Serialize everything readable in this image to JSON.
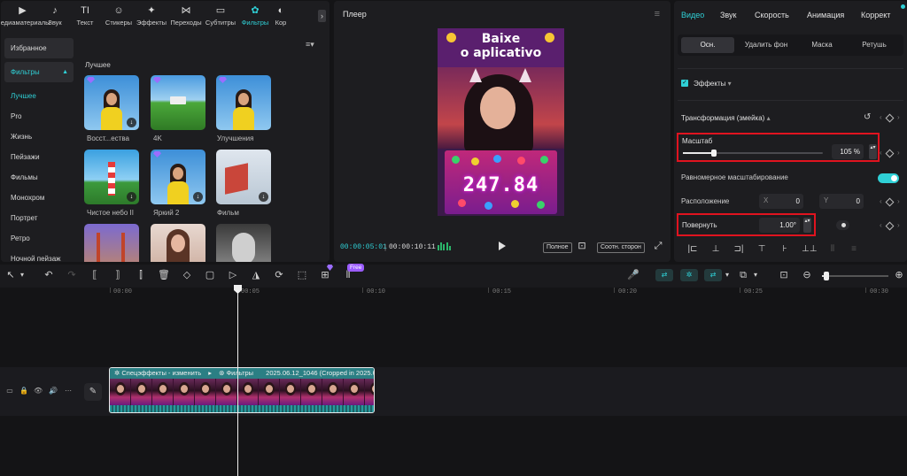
{
  "tool_tabs": [
    {
      "label": "Медиаматериалы",
      "icon": "media-icon",
      "glyph": "▶"
    },
    {
      "label": "Звук",
      "icon": "sound-icon",
      "glyph": "♪"
    },
    {
      "label": "Текст",
      "icon": "text-icon",
      "glyph": "TI"
    },
    {
      "label": "Стикеры",
      "icon": "sticker-icon",
      "glyph": "☺"
    },
    {
      "label": "Эффекты",
      "icon": "effects-icon",
      "glyph": "✦"
    },
    {
      "label": "Переходы",
      "icon": "transitions-icon",
      "glyph": "⋈"
    },
    {
      "label": "Субтитры",
      "icon": "subtitles-icon",
      "glyph": "▭"
    },
    {
      "label": "Фильтры",
      "icon": "filters-icon",
      "glyph": "✿"
    },
    {
      "label": "Кор",
      "icon": "adjust-icon",
      "glyph": "◐"
    }
  ],
  "tabs_arrow": "›",
  "left_panel": {
    "favorites": "Избранное",
    "filters_header": "Фильтры",
    "categories": [
      "Лучшее",
      "Pro",
      "Жизнь",
      "Пейзажи",
      "Фильмы",
      "Монохром",
      "Портрет",
      "Ретро",
      "Ночной пейзаж"
    ],
    "sort_icon": "≡▾",
    "section_title": "Лучшее",
    "thumbnails": [
      {
        "label": "Восст...ества"
      },
      {
        "label": "4K"
      },
      {
        "label": "Улучшения"
      },
      {
        "label": "Чистое небо II"
      },
      {
        "label": "Яркий 2"
      },
      {
        "label": "Фильм"
      },
      {
        "label": ""
      },
      {
        "label": ""
      },
      {
        "label": ""
      }
    ]
  },
  "player": {
    "title": "Плеер",
    "menu_icon": "≡",
    "caption_line1": "Baixe",
    "caption_line2": "o aplicativo",
    "win_amount": "247.84",
    "time_current": "00:00:05:01",
    "time_sep": "|",
    "time_total": "00:00:10:11",
    "full_btn": "Полное",
    "ratio_btn": "Соотн. сторон",
    "fit_icon": "⊡",
    "expand_icon": "⤢"
  },
  "inspector": {
    "tabs": [
      "Видео",
      "Звук",
      "Скорость",
      "Анимация",
      "Коррект"
    ],
    "subtabs": [
      "Осн.",
      "Удалить фон",
      "Маска",
      "Ретушь"
    ],
    "effects_label": "Эффекты",
    "effects_caret": "▾",
    "transform_label": "Трансформация (змейка)",
    "transform_caret": "▴",
    "scale_label": "Масштаб",
    "scale_value": "105 %",
    "scale_fraction": 0.22,
    "uniform_label": "Равномерное масштабирование",
    "uniform_on": true,
    "position_label": "Расположение",
    "pos_x_label": "X",
    "pos_x": "0",
    "pos_y_label": "Y",
    "pos_y": "0",
    "rotate_label": "Повернуть",
    "rotate_value": "1.00°",
    "check_glyph": "✓",
    "reset_glyph": "↺",
    "stepper_glyph": "▴▾",
    "arrow_left": "‹",
    "arrow_right": "›",
    "align_icons": [
      "|⊏",
      "⊥",
      "⊐|",
      "⊤",
      "⊦",
      "⊥⊥",
      "⫴",
      "≡"
    ]
  },
  "toolbar": {
    "free_badge": "Free",
    "left_icons": [
      "↖",
      "▾",
      "↶",
      "↷",
      "⟦",
      "⟧",
      "⫿",
      "🗑",
      "◇",
      "▢",
      "▷",
      "◮",
      "⟳",
      "⬚",
      "⊞",
      "⫴"
    ],
    "right_icons": [
      "🎤",
      "⇄",
      "✲",
      "⇄",
      "▾",
      "⧉",
      "▾",
      "⊡",
      "⊖",
      "⊕"
    ]
  },
  "timeline": {
    "ticks": [
      "00:00",
      "00:05",
      "00:10",
      "00:15",
      "00:20",
      "00:25",
      "00:30"
    ],
    "track_icons": [
      "▭",
      "🔒",
      "👁",
      "🔊",
      "⋯"
    ],
    "edit_icon": "✎",
    "clip_effects": "Спецэффекты - изменить",
    "clip_filters": "Фильтры",
    "clip_name": "2025.06.12_1046 (Cropped in 2025.06.1"
  },
  "colors": {
    "accent": "#2fd0d6",
    "highlight_red": "#e0131f",
    "clip_teal": "#1e6166",
    "premium_purple": "#9b6dff"
  }
}
